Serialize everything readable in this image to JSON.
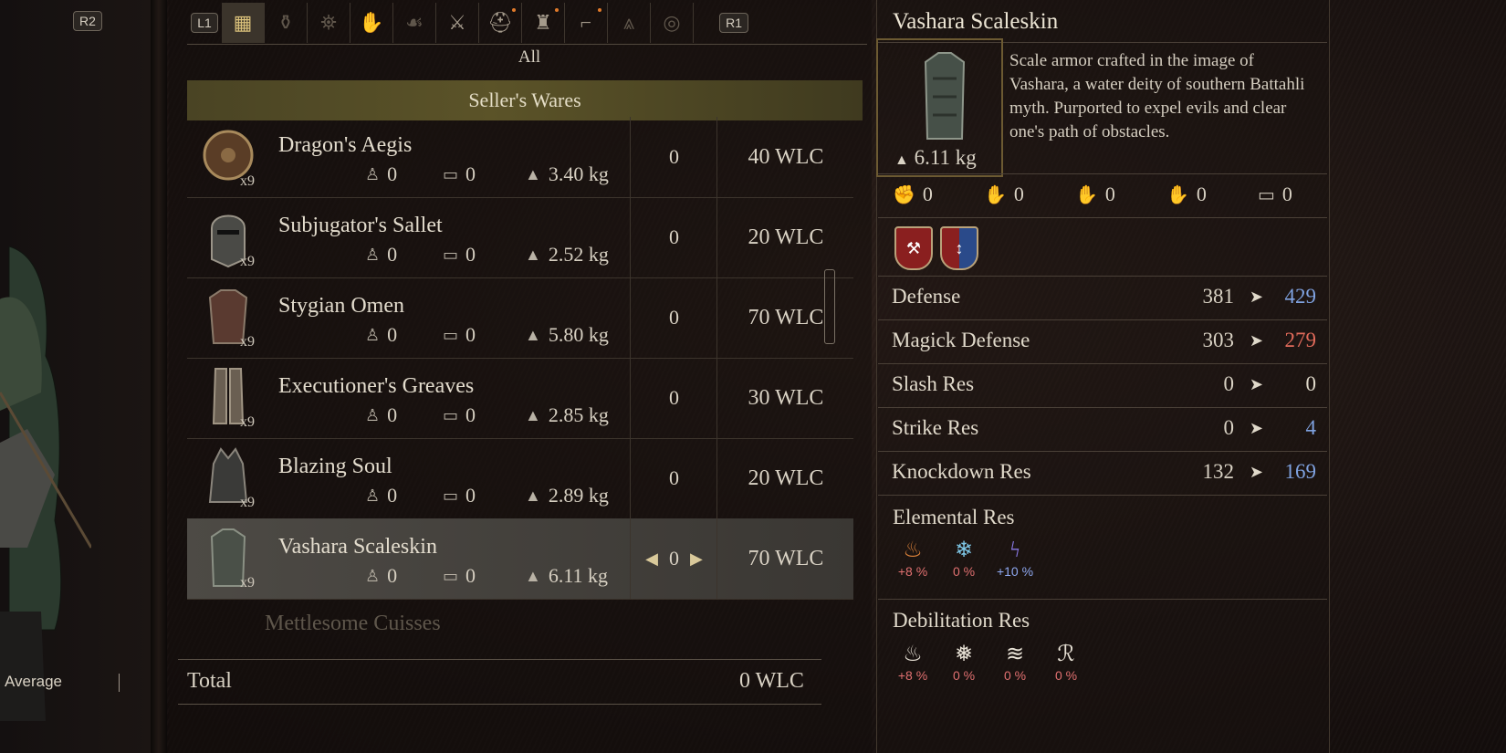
{
  "top": {
    "left_button": "R2",
    "tab_left_button": "L1",
    "tab_right_button": "R1"
  },
  "tabs": [
    {
      "icon": "grid-icon",
      "active": true
    },
    {
      "icon": "potion-icon"
    },
    {
      "icon": "lantern-icon"
    },
    {
      "icon": "hand-icon"
    },
    {
      "icon": "claw-icon"
    },
    {
      "icon": "sword-icon"
    },
    {
      "icon": "helmet-icon"
    },
    {
      "icon": "armor-icon"
    },
    {
      "icon": "boot-icon"
    },
    {
      "icon": "cloak-icon"
    },
    {
      "icon": "ring-icon"
    }
  ],
  "category_label": "All",
  "section_title": "Seller's Wares",
  "items": [
    {
      "name": "Dragon's Aegis",
      "qty": "x9",
      "stat1": "0",
      "stat2": "0",
      "weight": "3.40 kg",
      "count": "0",
      "price": "40 WLC",
      "icon": "shield-icon"
    },
    {
      "name": "Subjugator's Sallet",
      "qty": "x9",
      "stat1": "0",
      "stat2": "0",
      "weight": "2.52 kg",
      "count": "0",
      "price": "20 WLC",
      "icon": "helmet-icon"
    },
    {
      "name": "Stygian Omen",
      "qty": "x9",
      "stat1": "0",
      "stat2": "0",
      "weight": "5.80 kg",
      "count": "0",
      "price": "70 WLC",
      "icon": "armor-icon"
    },
    {
      "name": "Executioner's Greaves",
      "qty": "x9",
      "stat1": "0",
      "stat2": "0",
      "weight": "2.85 kg",
      "count": "0",
      "price": "30 WLC",
      "icon": "greaves-icon"
    },
    {
      "name": "Blazing Soul",
      "qty": "x9",
      "stat1": "0",
      "stat2": "0",
      "weight": "2.89 kg",
      "count": "0",
      "price": "20 WLC",
      "icon": "helmet-icon"
    },
    {
      "name": "Vashara Scaleskin",
      "qty": "x9",
      "stat1": "0",
      "stat2": "0",
      "weight": "6.11 kg",
      "count": "0",
      "price": "70 WLC",
      "icon": "armor-icon",
      "selected": true
    }
  ],
  "faded_item": "Mettlesome Cuisses",
  "total": {
    "label": "Total",
    "value": "0 WLC"
  },
  "character": {
    "label": "Average"
  },
  "detail": {
    "title": "Vashara Scaleskin",
    "weight": "6.11 kg",
    "description": "Scale armor crafted in the image of Vashara, a water deity of southern Battahli myth. Purported to expel evils and clear one's path of obstacles.",
    "mini_stats": [
      "0",
      "0",
      "0",
      "0",
      "0"
    ],
    "stats": [
      {
        "label": "Defense",
        "current": "381",
        "new": "429",
        "trend": "up"
      },
      {
        "label": "Magick Defense",
        "current": "303",
        "new": "279",
        "trend": "down"
      },
      {
        "label": "Slash Res",
        "current": "0",
        "new": "0",
        "trend": "same"
      },
      {
        "label": "Strike Res",
        "current": "0",
        "new": "4",
        "trend": "up"
      },
      {
        "label": "Knockdown Res",
        "current": "132",
        "new": "169",
        "trend": "up"
      }
    ],
    "elemental_title": "Elemental Res",
    "elemental": [
      {
        "icon": "fire-icon",
        "value": "+8 %"
      },
      {
        "icon": "ice-icon",
        "value": "0 %"
      },
      {
        "icon": "lightning-icon",
        "value": "+10 %"
      }
    ],
    "debilitation_title": "Debilitation Res",
    "debilitation": [
      {
        "icon": "burn-icon",
        "value": "+8 %"
      },
      {
        "icon": "frozen-icon",
        "value": "0 %"
      },
      {
        "icon": "drench-icon",
        "value": "0 %"
      },
      {
        "icon": "tar-icon",
        "value": "0 %"
      }
    ]
  }
}
